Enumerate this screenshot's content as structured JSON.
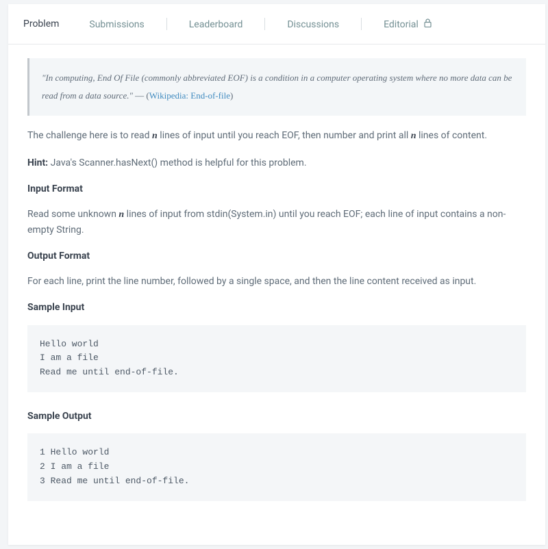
{
  "tabs": {
    "problem": "Problem",
    "submissions": "Submissions",
    "leaderboard": "Leaderboard",
    "discussions": "Discussions",
    "editorial": "Editorial"
  },
  "quote": {
    "text": "\"In computing, End Of File (commonly abbreviated EOF) is a condition in a computer operating system where no more data can be read from a data source.\"",
    "dash": " — (",
    "link_text": "Wikipedia: End-of-file",
    "close": ")"
  },
  "challenge": {
    "pre": "The challenge here is to read ",
    "n1": "n",
    "mid": " lines of input until you reach EOF, then number and print all ",
    "n2": "n",
    "post": " lines of content."
  },
  "hint": {
    "label": "Hint:",
    "text": " Java's Scanner.hasNext() method is helpful for this problem."
  },
  "input_format": {
    "heading": "Input Format",
    "pre": "Read some unknown ",
    "n": "n",
    "post": " lines of input from stdin(System.in) until you reach EOF; each line of input contains a non-empty String."
  },
  "output_format": {
    "heading": "Output Format",
    "text": "For each line, print the line number, followed by a single space, and then the line content received as input."
  },
  "sample_input": {
    "heading": "Sample Input",
    "code": "Hello world\nI am a file\nRead me until end-of-file."
  },
  "sample_output": {
    "heading": "Sample Output",
    "code": "1 Hello world\n2 I am a file\n3 Read me until end-of-file."
  }
}
